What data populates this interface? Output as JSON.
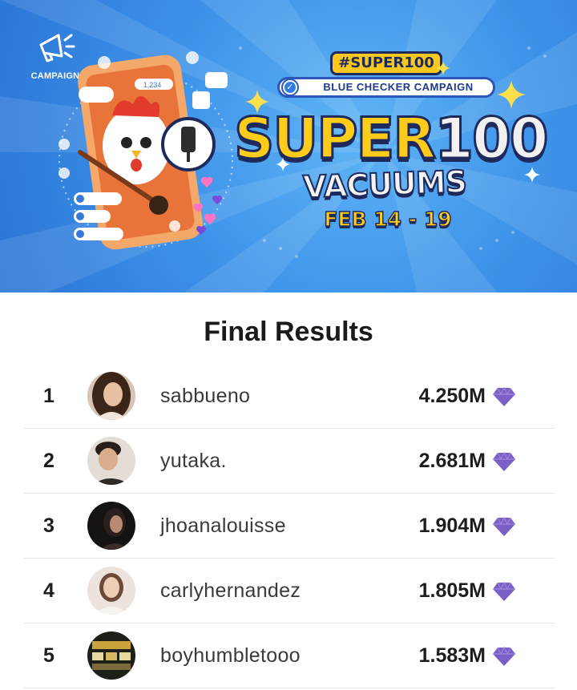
{
  "banner": {
    "campaign_label": "CAMPAIGN",
    "hashtag": "#SUPER100",
    "checker_label": "BLUE CHECKER CAMPAIGN",
    "title_word": "SUPER",
    "title_number": "100",
    "subtitle": "VACUUMS",
    "dates": "FEB 14 - 19",
    "viewer_count": "1,234",
    "colors": {
      "sky": "#3f95ea",
      "yellow": "#ffcc1a",
      "navy": "#1f2a5c"
    }
  },
  "results": {
    "title": "Final Results",
    "gem_icon": "diamond-icon",
    "gem_color": "#7a5fc4",
    "rows": [
      {
        "rank": "1",
        "username": "sabbueno",
        "score": "4.250M",
        "avatar_color": "#caa690"
      },
      {
        "rank": "2",
        "username": "yutaka.",
        "score": "2.681M",
        "avatar_color": "#d9d2ca"
      },
      {
        "rank": "3",
        "username": "jhoanalouisse",
        "score": "1.904M",
        "avatar_color": "#1d1a1a"
      },
      {
        "rank": "4",
        "username": "carlyhernandez",
        "score": "1.805M",
        "avatar_color": "#e3d8d0"
      },
      {
        "rank": "5",
        "username": "boyhumbletooo",
        "score": "1.583M",
        "avatar_color": "#2a2a24"
      }
    ]
  }
}
